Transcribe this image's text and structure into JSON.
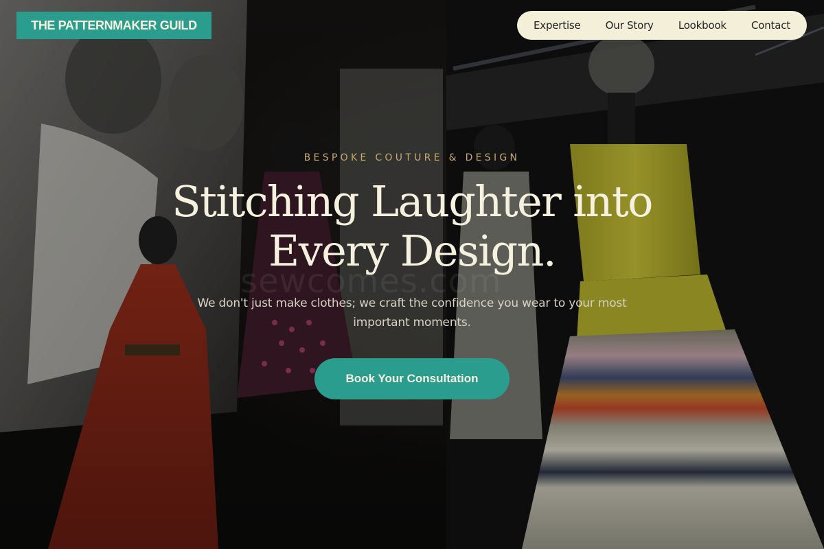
{
  "brand": {
    "name": "THE PATTERNMAKER GUILD"
  },
  "nav": {
    "items": [
      {
        "label": "Expertise"
      },
      {
        "label": "Our Story"
      },
      {
        "label": "Lookbook"
      },
      {
        "label": "Contact"
      }
    ]
  },
  "hero": {
    "kicker": "BESPOKE COUTURE & DESIGN",
    "headline_line1": "Stitching Laughter into",
    "headline_line2": "Every Design.",
    "subtitle": "We don't just make clothes; we craft the confidence you wear to your most important moments.",
    "cta_label": "Book Your Consultation",
    "watermark": "sewcomes.com"
  },
  "colors": {
    "accent": "#2a9d8f",
    "cream": "#f6f1de",
    "gold": "#c8a86b",
    "nav_bg": "#f3efd9"
  }
}
